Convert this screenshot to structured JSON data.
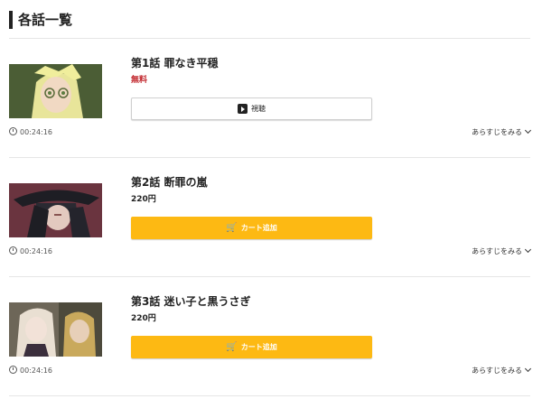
{
  "header": {
    "title": "各話一覧"
  },
  "episodes": [
    {
      "title": "第1話 罪なき平穏",
      "price": "無料",
      "button_label": "視聴",
      "duration": "00:24:16",
      "synopsis_label": "あらすじをみる"
    },
    {
      "title": "第2話 断罪の嵐",
      "price": "220円",
      "button_label": "カート追加",
      "duration": "00:24:16",
      "synopsis_label": "あらすじをみる"
    },
    {
      "title": "第3話 迷い子と黒うさぎ",
      "price": "220円",
      "button_label": "カート追加",
      "duration": "00:24:16",
      "synopsis_label": "あらすじをみる"
    }
  ],
  "colors": {
    "accent": "#fdb913",
    "free": "#c2272d",
    "divider": "#e6e6e6"
  },
  "icons": {
    "clock": "clock-icon",
    "play": "play-icon",
    "cart": "cart-icon",
    "chevron": "chevron-down-icon"
  }
}
